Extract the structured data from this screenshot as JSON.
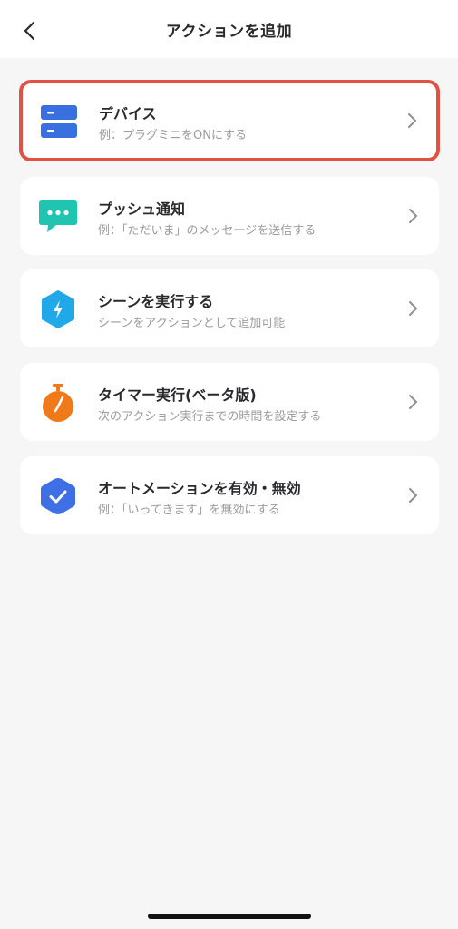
{
  "header": {
    "title": "アクションを追加",
    "back_icon": "chevron-left-icon"
  },
  "actions": [
    {
      "label": "デバイス",
      "subtitle": "例：プラグミニをONにする",
      "icon": "device-list-icon",
      "icon_color": "#3a6fe0",
      "selected": true
    },
    {
      "label": "プッシュ通知",
      "subtitle": "例：「ただいま」のメッセージを送信する",
      "icon": "chat-bubble-icon",
      "icon_color": "#1fc5b0",
      "selected": false
    },
    {
      "label": "シーンを実行する",
      "subtitle": "シーンをアクションとして追加可能",
      "icon": "lightning-hexagon-icon",
      "icon_color": "#20a8e8",
      "selected": false
    },
    {
      "label": "タイマー実行(ベータ版)",
      "subtitle": "次のアクション実行までの時間を設定する",
      "icon": "stopwatch-icon",
      "icon_color": "#f07a1a",
      "selected": false
    },
    {
      "label": "オートメーションを有効・無効",
      "subtitle": "例：「いってきます」を無効にする",
      "icon": "check-hexagon-icon",
      "icon_color": "#3f6fe4",
      "selected": false
    }
  ],
  "colors": {
    "background": "#f6f6f7",
    "selection_border": "#e05241"
  }
}
